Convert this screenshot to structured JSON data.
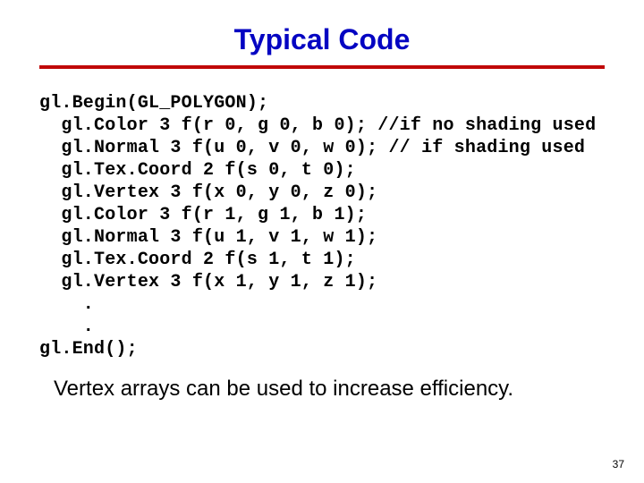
{
  "title": "Typical Code",
  "code_lines": [
    "gl.Begin(GL_POLYGON);",
    "  gl.Color 3 f(r 0, g 0, b 0); //if no shading used",
    "  gl.Normal 3 f(u 0, v 0, w 0); // if shading used",
    "  gl.Tex.Coord 2 f(s 0, t 0);",
    "  gl.Vertex 3 f(x 0, y 0, z 0);",
    "  gl.Color 3 f(r 1, g 1, b 1);",
    "  gl.Normal 3 f(u 1, v 1, w 1);",
    "  gl.Tex.Coord 2 f(s 1, t 1);",
    "  gl.Vertex 3 f(x 1, y 1, z 1);",
    "    .",
    "    .",
    "gl.End();"
  ],
  "footer": "Vertex arrays can be used to increase efficiency.",
  "page_number": "37"
}
